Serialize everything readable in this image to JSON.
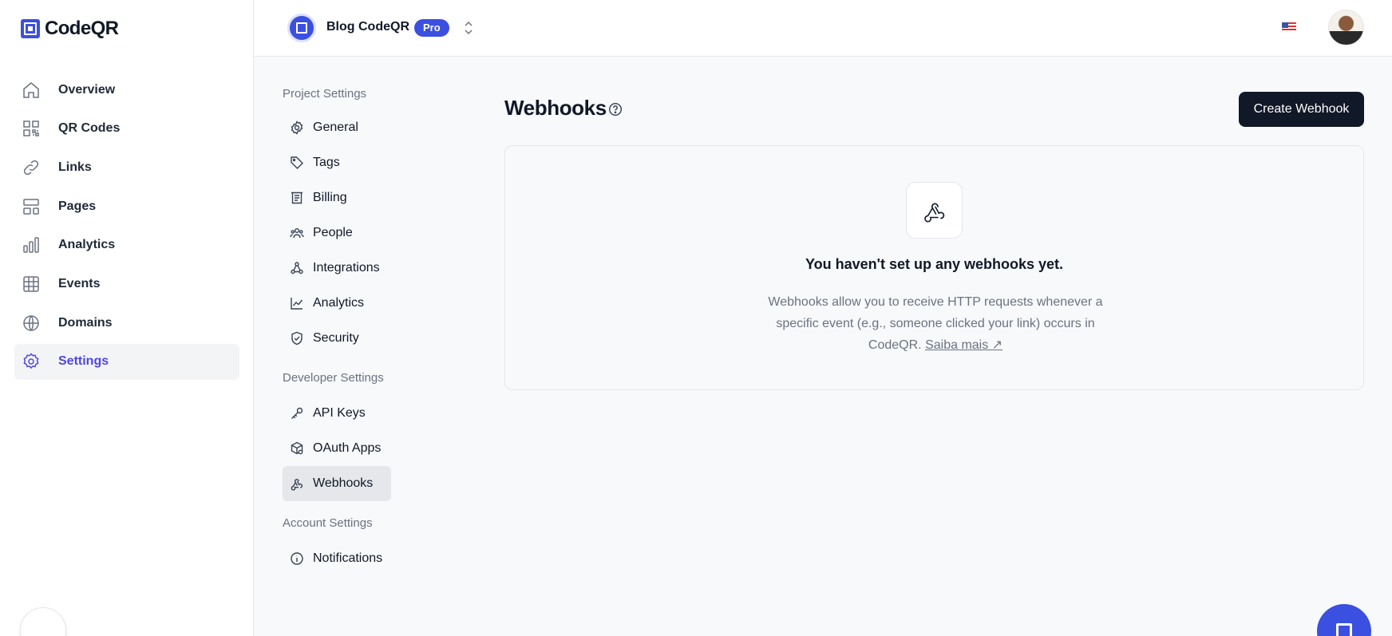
{
  "brand": {
    "name": "CodeQR"
  },
  "sidebar": {
    "items": [
      {
        "label": "Overview",
        "icon": "home-icon",
        "active": false
      },
      {
        "label": "QR Codes",
        "icon": "qr-code-icon",
        "active": false
      },
      {
        "label": "Links",
        "icon": "link-icon",
        "active": false
      },
      {
        "label": "Pages",
        "icon": "layout-icon",
        "active": false
      },
      {
        "label": "Analytics",
        "icon": "bar-chart-icon",
        "active": false
      },
      {
        "label": "Events",
        "icon": "grid-table-icon",
        "active": false
      },
      {
        "label": "Domains",
        "icon": "globe-icon",
        "active": false
      },
      {
        "label": "Settings",
        "icon": "gear-icon",
        "active": true
      }
    ]
  },
  "header": {
    "project_name": "Blog CodeQR",
    "plan_badge": "Pro"
  },
  "settings_nav": {
    "project_group": "Project Settings",
    "project_items": [
      {
        "label": "General",
        "icon": "cog-icon"
      },
      {
        "label": "Tags",
        "icon": "tag-icon"
      },
      {
        "label": "Billing",
        "icon": "receipt-icon"
      },
      {
        "label": "People",
        "icon": "people-icon"
      },
      {
        "label": "Integrations",
        "icon": "integrations-icon"
      },
      {
        "label": "Analytics",
        "icon": "line-chart-icon"
      },
      {
        "label": "Security",
        "icon": "shield-check-icon"
      }
    ],
    "developer_group": "Developer Settings",
    "developer_items": [
      {
        "label": "API Keys",
        "icon": "key-icon"
      },
      {
        "label": "OAuth Apps",
        "icon": "box-icon"
      },
      {
        "label": "Webhooks",
        "icon": "webhook-icon",
        "active": true
      }
    ],
    "account_group": "Account Settings",
    "account_items": [
      {
        "label": "Notifications",
        "icon": "info-icon"
      }
    ]
  },
  "main": {
    "title": "Webhooks",
    "create_button": "Create Webhook",
    "empty_title": "You haven't set up any webhooks yet.",
    "empty_description": "Webhooks allow you to receive HTTP requests whenever a specific event (e.g., someone clicked your link) occurs in CodeQR.",
    "learn_more": "Saiba mais ↗"
  },
  "colors": {
    "accent": "#3b4fe0",
    "active_text": "#4f46e5",
    "dark_button": "#111827"
  }
}
